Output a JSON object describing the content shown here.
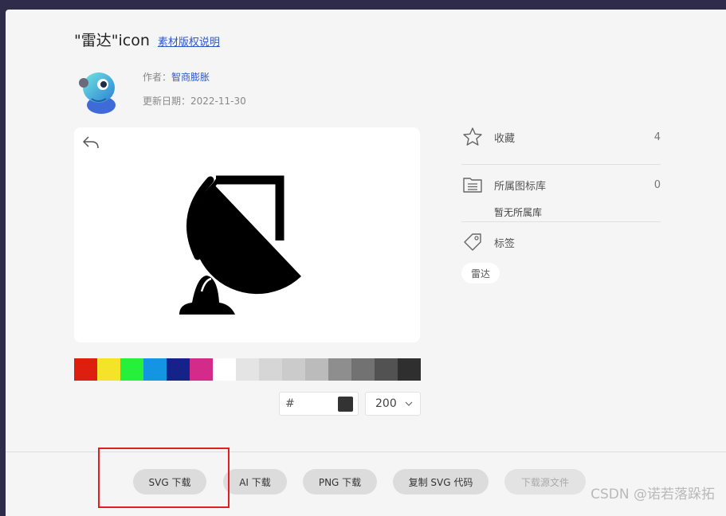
{
  "header": {
    "title": "\"雷达\"icon",
    "copyright_link": "素材版权说明"
  },
  "meta": {
    "author_label": "作者：",
    "author_name": "智商膨胀",
    "updated_label": "更新日期：",
    "updated_date": "2022-11-30"
  },
  "palette": {
    "colors": [
      "#de1e0f",
      "#f5e32a",
      "#26f03a",
      "#1495e3",
      "#14228a",
      "#d42a8a",
      "#ffffff",
      "#e4e4e4",
      "#d6d6d6",
      "#cbcbcb",
      "#bbbbbb",
      "#8e8e8e",
      "#727272",
      "#525252",
      "#2f2f2f"
    ]
  },
  "color_picker": {
    "hash": "#",
    "value": "",
    "current_color": "#333333"
  },
  "size_select": {
    "value": "200"
  },
  "sidebar": {
    "favorites": {
      "label": "收藏",
      "count": "4"
    },
    "library": {
      "label": "所属图标库",
      "count": "0",
      "empty_text": "暂无所属库"
    },
    "tags": {
      "label": "标签",
      "items": [
        "雷达"
      ]
    }
  },
  "footer": {
    "svg_download": "SVG 下载",
    "ai_download": "AI 下载",
    "png_download": "PNG 下载",
    "copy_svg": "复制 SVG 代码",
    "source_download": "下载源文件"
  },
  "watermark": "CSDN @诺若落跺拓"
}
